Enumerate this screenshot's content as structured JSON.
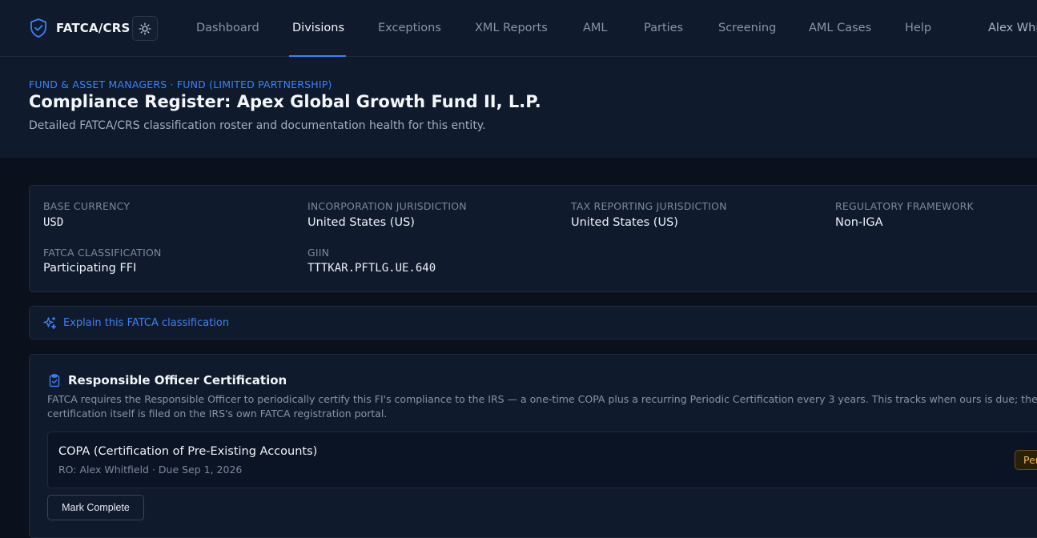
{
  "app": {
    "brand": "FATCA/CRS",
    "user_name": "Alex Whitfield"
  },
  "nav": {
    "items": [
      "Dashboard",
      "Divisions",
      "Exceptions",
      "XML Reports",
      "AML",
      "Parties",
      "Screening",
      "AML Cases",
      "Help"
    ],
    "active": "Divisions"
  },
  "header": {
    "eyebrow": "FUND & ASSET MANAGERS · FUND (LIMITED PARTNERSHIP)",
    "title": "Compliance Register: Apex Global Growth Fund II, L.P.",
    "subtitle": "Detailed FATCA/CRS classification roster and documentation health for this entity."
  },
  "entity": {
    "base_currency_label": "BASE CURRENCY",
    "base_currency": "USD",
    "incorporation_label": "INCORPORATION JURISDICTION",
    "incorporation": "United States (US)",
    "tax_reporting_label": "TAX REPORTING JURISDICTION",
    "tax_reporting": "United States (US)",
    "framework_label": "REGULATORY FRAMEWORK",
    "framework": "Non-IGA",
    "fatca_class_label": "FATCA CLASSIFICATION",
    "fatca_class": "Participating FFI",
    "giin_label": "GIIN",
    "giin": "TTTKAR.PFTLG.UE.640"
  },
  "explain": {
    "label": "Explain this FATCA classification"
  },
  "certification": {
    "title": "Responsible Officer Certification",
    "description": "FATCA requires the Responsible Officer to periodically certify this FI's compliance to the IRS — a one-time COPA plus a recurring Periodic Certification every 3 years. This tracks when ours is due; the certification itself is filed on the IRS's own FATCA registration portal.",
    "item_title": "COPA (Certification of Pre-Existing Accounts)",
    "item_meta": "RO: Alex Whitfield · Due Sep 1, 2026",
    "status": "Pending",
    "action": "Mark Complete"
  },
  "colors": {
    "accent": "#3b82f6",
    "background": "#0b111c",
    "panel": "#0f1a2c",
    "pending": "#f2b84b"
  },
  "icons": [
    "shield-check-icon",
    "sun-icon",
    "sparkles-icon",
    "clipboard-check-icon"
  ]
}
